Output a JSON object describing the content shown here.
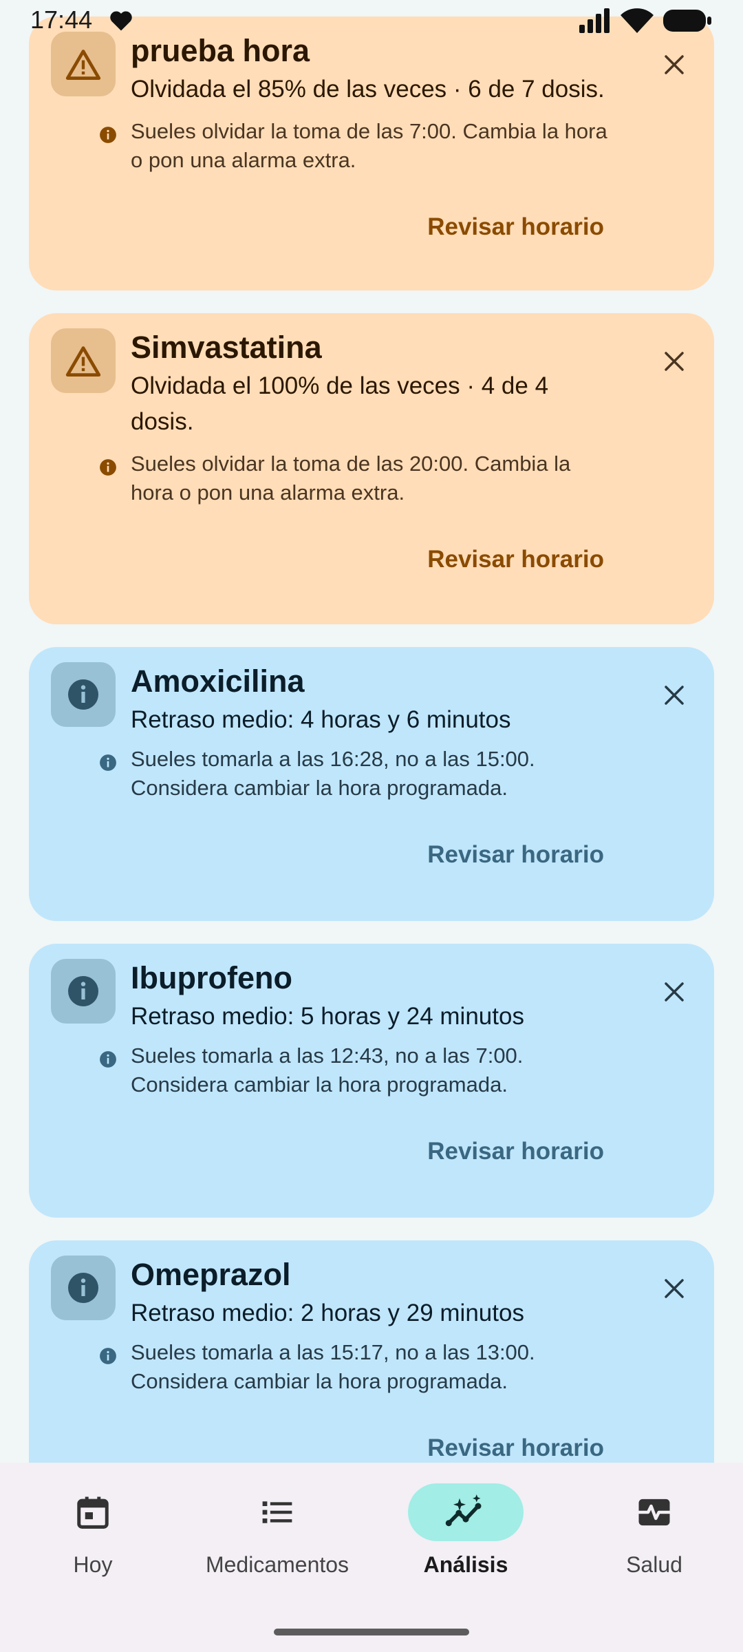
{
  "status_bar": {
    "time": "17:44"
  },
  "cards": [
    {
      "kind": "warning",
      "title": "prueba hora",
      "subtitle": "Olvidada el 85% de las veces · 6 de 7 dosis.",
      "note": "Sueles olvidar la toma de las 7:00. Cambia la hora o pon una alarma extra.",
      "action": "Revisar horario"
    },
    {
      "kind": "warning",
      "title": "Simvastatina",
      "subtitle": "Olvidada el 100% de las veces · 4 de 4 dosis.",
      "note": "Sueles olvidar la toma de las 20:00. Cambia la hora o pon una alarma extra.",
      "action": "Revisar horario"
    },
    {
      "kind": "info",
      "title": "Amoxicilina",
      "subtitle": "Retraso medio: 4 horas y 6 minutos",
      "note": "Sueles tomarla a las 16:28, no a las 15:00. Considera cambiar la hora programada.",
      "action": "Revisar horario"
    },
    {
      "kind": "info",
      "title": "Ibuprofeno",
      "subtitle": "Retraso medio: 5 horas y 24 minutos",
      "note": "Sueles tomarla a las 12:43, no a las 7:00. Considera cambiar la hora programada.",
      "action": "Revisar horario"
    },
    {
      "kind": "info",
      "title": "Omeprazol",
      "subtitle": "Retraso medio: 2 horas y 29 minutos",
      "note": "Sueles tomarla a las 15:17, no a las 13:00. Considera cambiar la hora programada.",
      "action": "Revisar horario"
    }
  ],
  "bottom_nav": {
    "items": [
      {
        "label": "Hoy",
        "icon": "calendar-icon",
        "active": false
      },
      {
        "label": "Medicamentos",
        "icon": "list-icon",
        "active": false
      },
      {
        "label": "Análisis",
        "icon": "insights-icon",
        "active": true
      },
      {
        "label": "Salud",
        "icon": "monitor-heart-icon",
        "active": false
      }
    ]
  },
  "colors": {
    "warning_card": "#FFDDB8",
    "warning_badge": "#E7BE8E",
    "warning_accent": "#8A4B00",
    "info_card": "#C0E6FB",
    "info_badge": "#98C1D6",
    "info_accent": "#3A6781",
    "nav_active_pill": "#A2EDE6",
    "background": "#F1F6F7"
  }
}
